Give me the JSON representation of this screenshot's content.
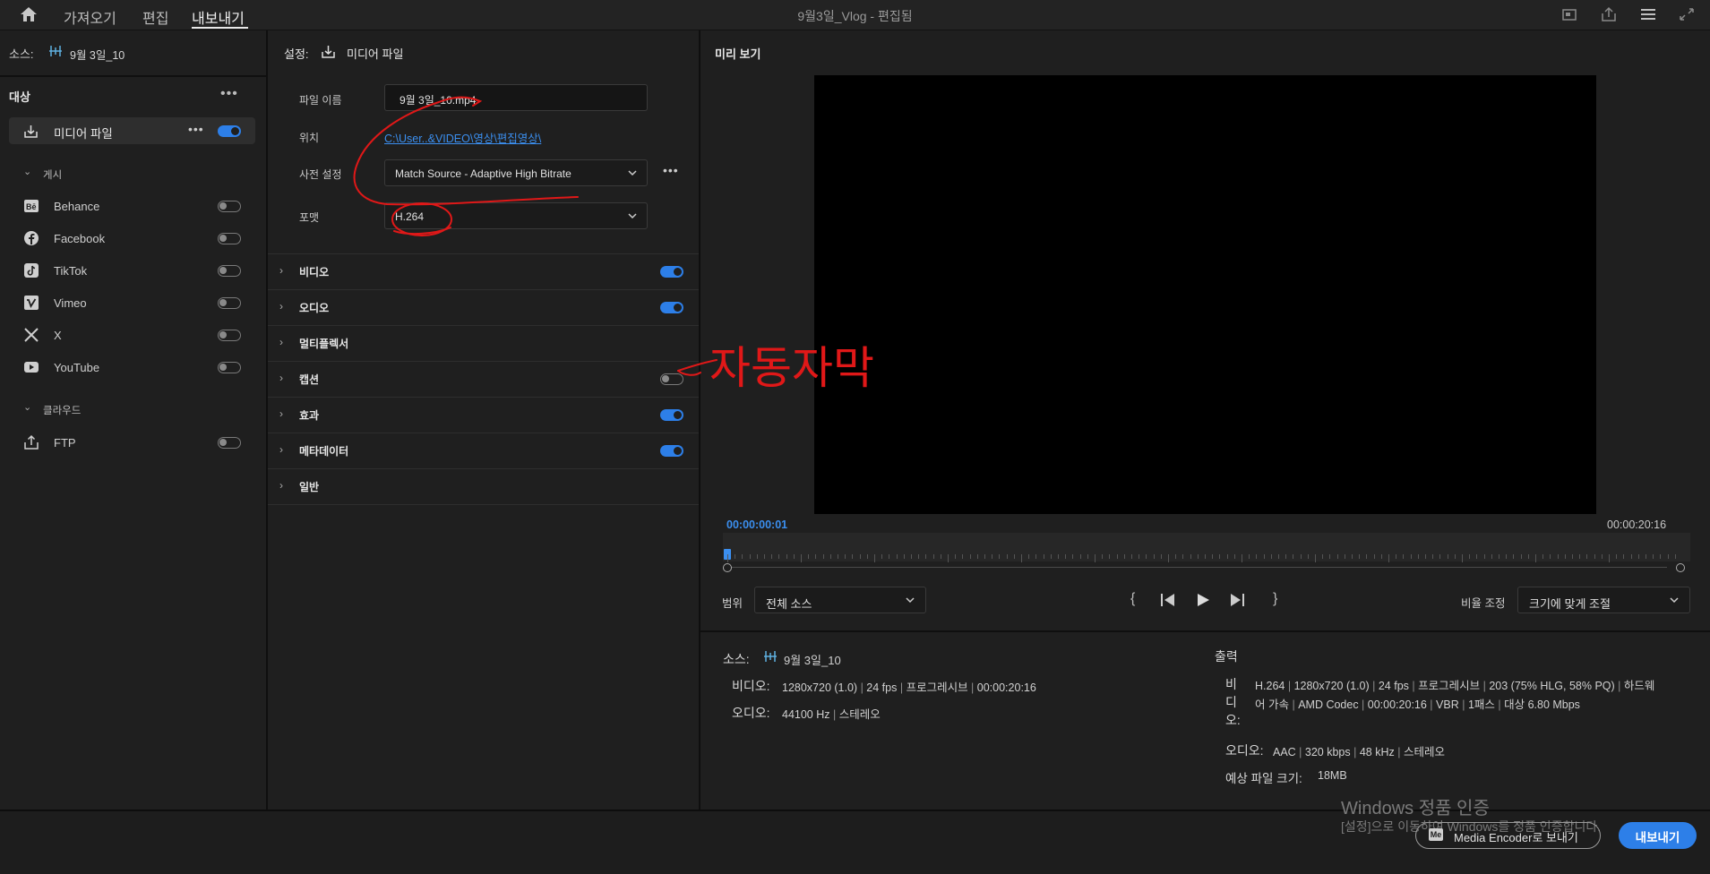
{
  "topbar": {
    "tabs": [
      {
        "label": "가져오기"
      },
      {
        "label": "편집"
      },
      {
        "label": "내보내기"
      }
    ],
    "active_tab": "내보내기",
    "title": "9월3일_Vlog",
    "title_suffix": " - 편집됨"
  },
  "source_bar": {
    "label": "소스:",
    "sequence": "9월 3일_10"
  },
  "destinations": {
    "header": "대상",
    "primary": {
      "label": "미디어 파일",
      "enabled": true
    },
    "publish_group": "게시",
    "publish": [
      {
        "label": "Behance",
        "icon": "behance-icon",
        "enabled": false
      },
      {
        "label": "Facebook",
        "icon": "facebook-icon",
        "enabled": false
      },
      {
        "label": "TikTok",
        "icon": "tiktok-icon",
        "enabled": false
      },
      {
        "label": "Vimeo",
        "icon": "vimeo-icon",
        "enabled": false
      },
      {
        "label": "X",
        "icon": "x-icon",
        "enabled": false
      },
      {
        "label": "YouTube",
        "icon": "youtube-icon",
        "enabled": false
      }
    ],
    "cloud_group": "클라우드",
    "cloud": [
      {
        "label": "FTP",
        "icon": "upload-icon",
        "enabled": false
      }
    ]
  },
  "settings": {
    "header_label": "설정:",
    "header_target": "미디어 파일",
    "file_name_label": "파일 이름",
    "file_name": "9월 3일_10.mp4",
    "location_label": "위치",
    "location": "C:\\User..&VIDEO\\영상\\편집영상\\",
    "preset_label": "사전 설정",
    "preset": "Match Source - Adaptive High Bitrate",
    "format_label": "포맷",
    "format": "H.264",
    "sections": [
      {
        "label": "비디오",
        "enabled": true
      },
      {
        "label": "오디오",
        "enabled": true
      },
      {
        "label": "멀티플렉서",
        "enabled": null
      },
      {
        "label": "캡션",
        "enabled": false
      },
      {
        "label": "효과",
        "enabled": true
      },
      {
        "label": "메타데이터",
        "enabled": true
      },
      {
        "label": "일반",
        "enabled": null
      }
    ]
  },
  "annotation": {
    "text": "자동자막",
    "color": "#e01818"
  },
  "preview": {
    "header": "미리 보기",
    "current_time": "00:00:00:01",
    "duration": "00:00:20:16",
    "range_label": "범위",
    "range_value": "전체 소스",
    "scale_label": "비율 조정",
    "scale_value": "크기에 맞게 조절"
  },
  "summary": {
    "source_label": "소스:",
    "source_name": "9월 3일_10",
    "source_video_label": "비디오:",
    "source_video": [
      "1280x720 (1.0)",
      "24 fps",
      "프로그레시브",
      "00:00:20:16"
    ],
    "source_audio_label": "오디오:",
    "source_audio": [
      "44100 Hz",
      "스테레오"
    ],
    "output_label": "출력",
    "output_video_label": "비디오:",
    "output_video_line1": [
      "H.264",
      "1280x720 (1.0)",
      "24 fps",
      "프로그레시브",
      "203 (75% HLG, 58% PQ)",
      "하드웨"
    ],
    "output_video_line2": [
      "어 가속",
      "AMD Codec",
      "00:00:20:16 ",
      "VBR",
      "1패스",
      "대상 6.80 Mbps"
    ],
    "output_audio_label": "오디오:",
    "output_audio": [
      "AAC",
      "320 kbps",
      "48 kHz",
      "스테레오"
    ],
    "file_size_label": "예상 파일 크기:",
    "file_size": "18MB"
  },
  "bottom": {
    "watermark_title": "Windows 정품 인증",
    "watermark_sub": "[설정]으로 이동하여 Windows를 정품 인증합니다.",
    "media_encoder_label": "Media Encoder로 보내기",
    "export_label": "내보내기"
  },
  "colors": {
    "accent": "#2d7fe8",
    "timecode": "#3b8ff0",
    "link": "#3b8ff0"
  }
}
